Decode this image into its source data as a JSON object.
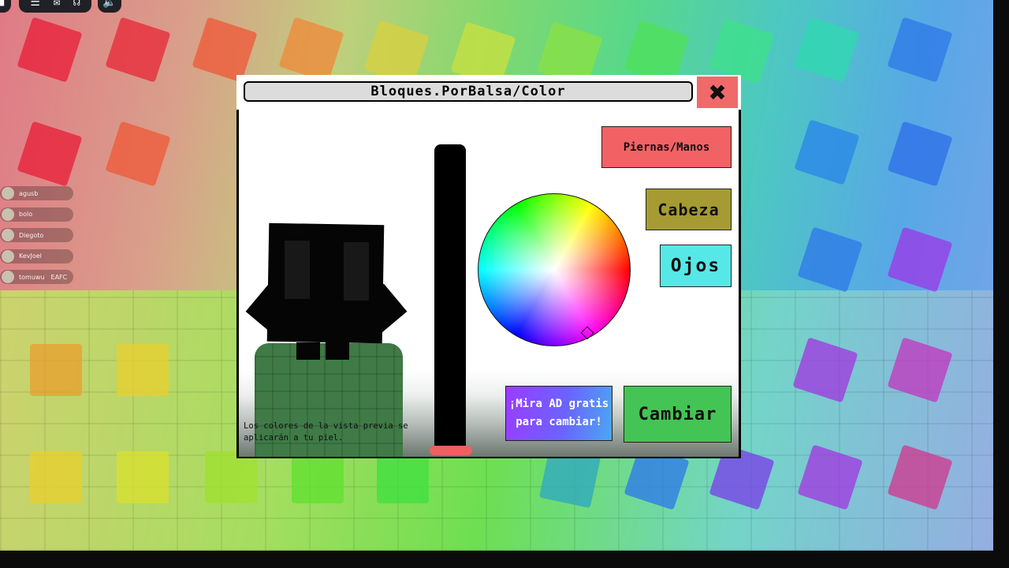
{
  "modal": {
    "title": "Bloques.PorBalsa/Color",
    "close_label": "✖",
    "preview_note": "Los colores de la vista previa se aplicarán a tu piel.",
    "buttons": {
      "legs_hands": "Piernas/Manos",
      "head": "Cabeza",
      "eyes": "Ojos",
      "watch_ad": "¡Mira AD gratis para cambiar!",
      "change": "Cambiar"
    },
    "brightness_level": 0.0
  },
  "players": [
    {
      "name": "agusb"
    },
    {
      "name": "bolo"
    },
    {
      "name": "Diegoto"
    },
    {
      "name": "KevJoel"
    },
    {
      "name": "tomuwu",
      "tag": "EAFC"
    }
  ],
  "colors": {
    "legs_button": "#f26264",
    "head_button": "#a59b32",
    "eyes_button": "#56e8e6",
    "change_button": "#44c454",
    "close_button": "#f06a6a",
    "slider_handle": "#f06060"
  }
}
